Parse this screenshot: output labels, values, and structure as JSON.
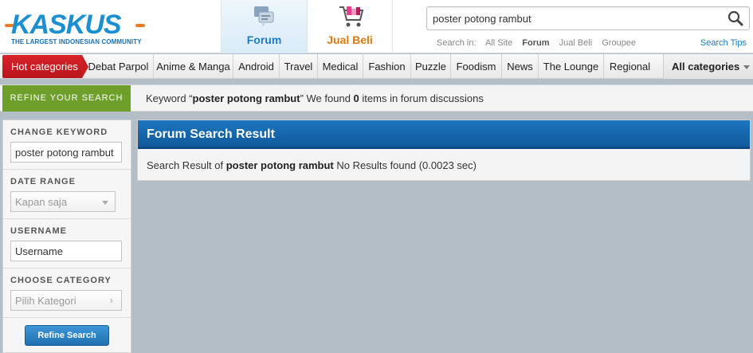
{
  "logo": {
    "wordmark": "KASKUS",
    "tagline": "THE LARGEST INDONESIAN COMMUNITY"
  },
  "nav": {
    "forum": "Forum",
    "jualbeli": "Jual Beli"
  },
  "search": {
    "value": "poster potong rambut",
    "search_in_label": "Search in:",
    "options": [
      "All Site",
      "Forum",
      "Jual Beli",
      "Groupee"
    ],
    "active_option": "Forum",
    "tips": "Search Tips"
  },
  "categories": {
    "hot": "Hot categories",
    "items": [
      "Debat Parpol",
      "Anime & Manga",
      "Android",
      "Travel",
      "Medical",
      "Fashion",
      "Puzzle",
      "Foodism",
      "News",
      "The Lounge",
      "Regional"
    ],
    "all": "All categories"
  },
  "refine": {
    "tab": "REFINE YOUR SEARCH",
    "msg_prefix": "Keyword “",
    "keyword": "poster potong rambut",
    "msg_mid": "” We found ",
    "count": "0",
    "msg_suffix": " items in forum discussions"
  },
  "sidebar": {
    "change_keyword_title": "CHANGE KEYWORD",
    "keyword_value": "poster potong rambut",
    "date_range_title": "DATE RANGE",
    "date_range_value": "Kapan saja",
    "username_title": "USERNAME",
    "username_placeholder": "Username",
    "category_title": "CHOOSE CATEGORY",
    "category_value": "Pilih Kategori",
    "refine_button": "Refine Search"
  },
  "result": {
    "title": "Forum Search Result",
    "prefix": "Search Result of ",
    "keyword": "poster potong rambut",
    "suffix": " No Results found (0.0023 sec)"
  },
  "colors": {
    "brand_blue": "#1a8fd2",
    "brand_orange": "#f47a1f",
    "hot_red": "#d9232a",
    "refine_green": "#6f9f2b",
    "result_blue": "#1c76bf"
  }
}
